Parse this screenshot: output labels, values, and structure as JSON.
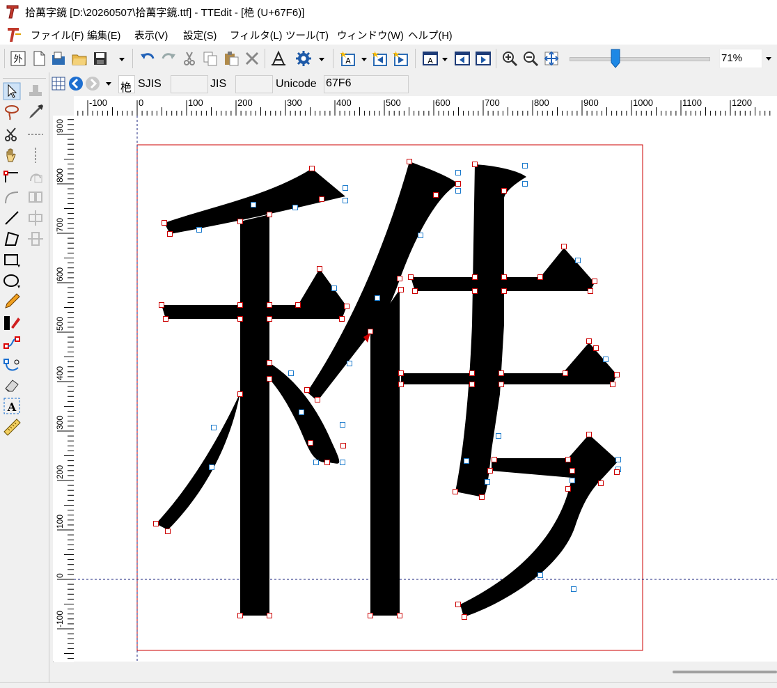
{
  "window": {
    "title": "拾萬字鏡 [D:\\20260507\\拾萬字鏡.ttf] - TTEdit - [栬 (U+67F6)]",
    "app_icon": "ttedit-logo-icon"
  },
  "menu": {
    "items": [
      "ファイル(F)",
      "編集(E)",
      "表示(V)",
      "設定(S)",
      "フィルタ(L)",
      "ツール(T)",
      "ウィンドウ(W)",
      "ヘルプ(H)"
    ]
  },
  "toolbar": {
    "zoom_value": "71%",
    "zoom_slider_level": 0.33,
    "buttons": [
      "outline-char-icon",
      "new-file-icon",
      "open-file-icon",
      "open-folder-icon",
      "save-icon",
      "undo-icon",
      "redo-icon",
      "cut-icon",
      "copy-icon",
      "paste-icon",
      "delete-icon",
      "font-info-icon",
      "settings-gear-icon",
      "new-glyph-icon",
      "prev-glyph-icon",
      "next-glyph-icon",
      "window-glyph-icon",
      "window-prev-icon",
      "window-next-icon",
      "zoom-in-icon",
      "zoom-out-icon",
      "fit-window-icon"
    ]
  },
  "charbar": {
    "char": "栬",
    "sjis_label": "SJIS",
    "sjis_value": "",
    "jis_label": "JIS",
    "jis_value": "",
    "unicode_label": "Unicode",
    "unicode_value": "67F6"
  },
  "tools": [
    "select-arrow-icon",
    "lasso-icon",
    "scissors-icon",
    "hand-pan-icon",
    "add-point-icon",
    "curve-point-icon",
    "line-tool-icon",
    "polygon-tool-icon",
    "rectangle-tool-icon",
    "ellipse-tool-icon",
    "pencil-tool-icon",
    "brush-tool-icon",
    "node-edit-icon",
    "node-curve-icon",
    "eraser-icon",
    "text-tool-icon",
    "ruler-measure-icon"
  ],
  "tools_right": [
    "stamp-icon",
    "eyedropper-icon",
    "dashed-line-icon",
    "vertical-dashed-icon",
    "rotate-icon",
    "flip-icon",
    "align-h-icon",
    "align-v-icon"
  ],
  "rulers": {
    "h_ticks": [
      "-100",
      "0",
      "100",
      "200",
      "300",
      "400",
      "500",
      "600",
      "700",
      "800",
      "900",
      "1000",
      "1100",
      "1200"
    ],
    "v_ticks": [
      "900",
      "800",
      "700",
      "600",
      "500",
      "400",
      "300",
      "200",
      "100",
      "0",
      "-100"
    ]
  },
  "colors": {
    "glyph": "#000000",
    "on_curve_point": "#cc0000",
    "off_curve_point": "#1a7acc",
    "em_box": "#cc0000",
    "baseline": "#1a237e"
  }
}
